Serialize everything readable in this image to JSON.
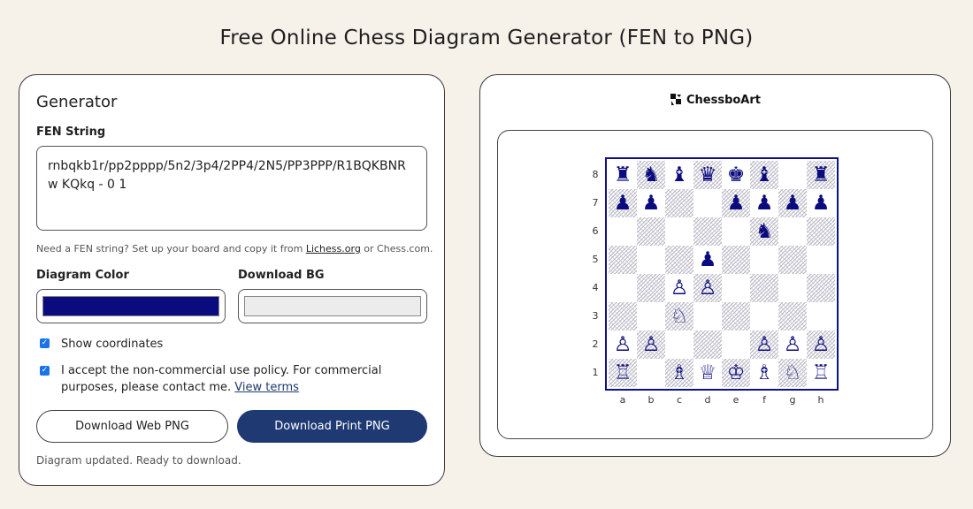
{
  "page": {
    "title": "Free Online Chess Diagram Generator (FEN to PNG)"
  },
  "generator": {
    "heading": "Generator",
    "fen_label": "FEN String",
    "fen_value": "rnbqkb1r/pp2pppp/5n2/3p4/2PP4/2N5/PP3PPP/R1BQKBNR w KQkq - 0 1",
    "help_prefix": "Need a FEN string? Set up your board and copy it from ",
    "help_link": "Lichess.org",
    "help_suffix": " or Chess.com.",
    "diagram_color_label": "Diagram Color",
    "diagram_color": "#0b0b80",
    "download_bg_label": "Download BG",
    "download_bg": "#ececec",
    "show_coords_label": "Show coordinates",
    "show_coords_checked": true,
    "accept_label": "I accept the non-commercial use policy. For commercial purposes, please contact me.",
    "accept_link": "View terms",
    "accept_checked": true,
    "btn_web": "Download Web PNG",
    "btn_print": "Download Print PNG",
    "status": "Diagram updated. Ready to download."
  },
  "preview": {
    "brand": "ChessboArt",
    "ranks": [
      "8",
      "7",
      "6",
      "5",
      "4",
      "3",
      "2",
      "1"
    ],
    "files": [
      "a",
      "b",
      "c",
      "d",
      "e",
      "f",
      "g",
      "h"
    ]
  },
  "colors": {
    "accent": "#1f3a73",
    "page_bg": "#f6f2ea",
    "board": "#0b0b80"
  }
}
